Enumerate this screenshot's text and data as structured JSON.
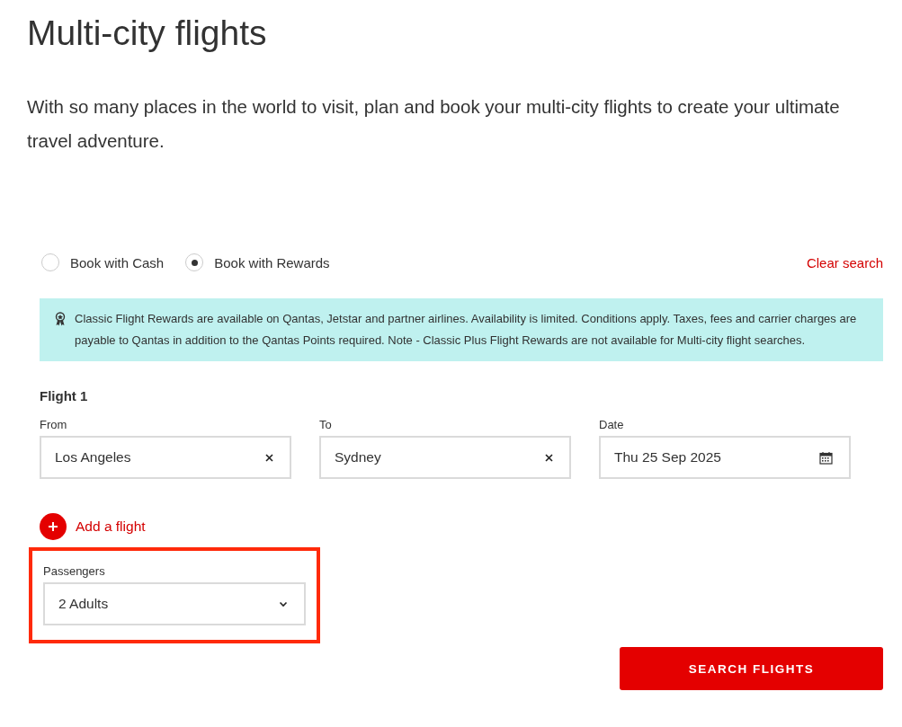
{
  "title": "Multi-city flights",
  "intro": "With so many places in the world to visit, plan and book your multi-city flights to create your ultimate travel adventure.",
  "booking_options": [
    {
      "label": "Book with Cash",
      "selected": false
    },
    {
      "label": "Book with Rewards",
      "selected": true
    }
  ],
  "clear_search": "Clear search",
  "notice": "Classic Flight Rewards are available on Qantas, Jetstar and partner airlines. Availability is limited. Conditions apply. Taxes, fees and carrier charges are payable to Qantas in addition to the Qantas Points required. Note - Classic Plus Flight Rewards are not available for Multi-city flight searches.",
  "flight": {
    "heading": "Flight 1",
    "fields": [
      {
        "label": "From",
        "value": "Los Angeles",
        "kind": "clearable"
      },
      {
        "label": "To",
        "value": "Sydney",
        "kind": "clearable"
      },
      {
        "label": "Date",
        "value": "Thu 25 Sep 2025",
        "kind": "date"
      }
    ]
  },
  "add_flight": "Add a flight",
  "passengers": {
    "label": "Passengers",
    "value": "2 Adults",
    "highlighted": true
  },
  "search_button": "SEARCH FLIGHTS"
}
